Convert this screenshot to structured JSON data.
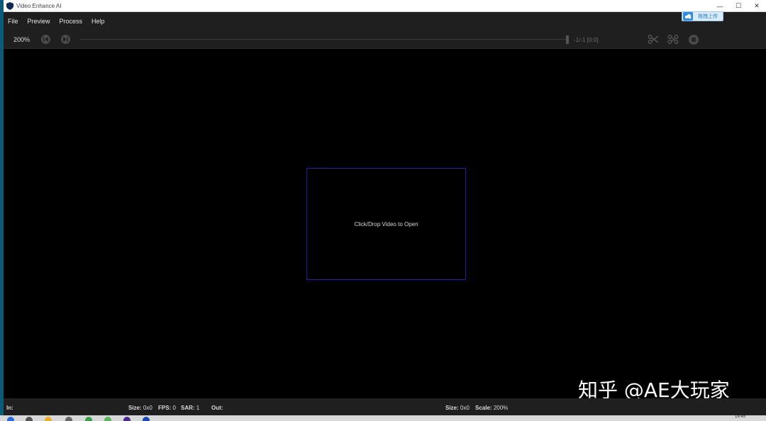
{
  "window": {
    "title": "Video Enhance AI",
    "minimize": "—",
    "maximize": "☐",
    "close": "✕"
  },
  "menu": [
    "File",
    "Preview",
    "Process",
    "Help"
  ],
  "upload_pill": {
    "label": "拖拽上传"
  },
  "toolbar": {
    "zoom": "200%",
    "frame_counter": "-1/-1  [0:0]"
  },
  "viewport": {
    "drop_prompt": "Click/Drop Video to Open"
  },
  "watermark": "知乎 @AE大玩家",
  "status": {
    "in_label": "In:",
    "in_size_label": "Size:",
    "in_size_value": "0x0",
    "fps_label": "FPS:",
    "fps_value": "0",
    "sar_label": "SAR:",
    "sar_value": "1",
    "out_label": "Out:",
    "out_size_label": "Size:",
    "out_size_value": "0x0",
    "scale_label": "Scale:",
    "scale_value": "200%"
  },
  "taskbar": {
    "clock": "19:45"
  },
  "colors": {
    "accent_blue": "#1c1ca8",
    "toolbar_bg": "#1f1f1f",
    "upload_blue": "#2a8ce6"
  }
}
